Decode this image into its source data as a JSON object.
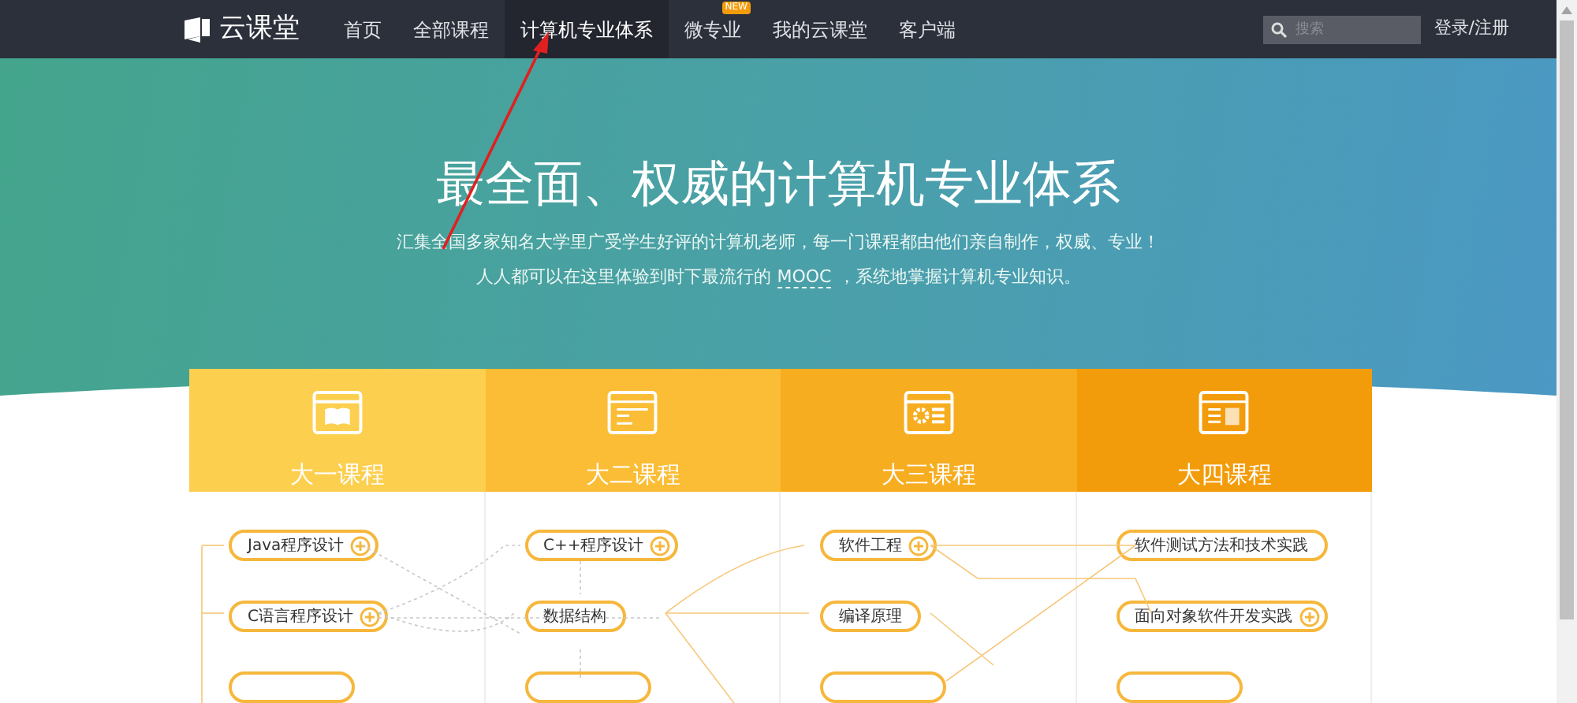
{
  "nav": {
    "logo": "云课堂",
    "items": [
      {
        "label": "首页",
        "selected": false
      },
      {
        "label": "全部课程",
        "selected": false
      },
      {
        "label": "计算机专业体系",
        "selected": true
      },
      {
        "label": "微专业",
        "selected": false,
        "badge": "NEW"
      },
      {
        "label": "我的云课堂",
        "selected": false
      },
      {
        "label": "客户端",
        "selected": false
      }
    ],
    "search": {
      "placeholder": "搜索"
    },
    "login": "登录/注册"
  },
  "hero": {
    "title": "最全面、权威的计算机专业体系",
    "lines": [
      [
        {
          "kind": "plain",
          "text": "汇集全国多家知名大学里广受学生好评的计算机老师，每一门课程都由他们亲自制作，权威、专业！"
        }
      ],
      [
        {
          "kind": "plain",
          "text": "人人都可以在这里体验到时下最流行的"
        },
        {
          "kind": "link",
          "text": "MOOC"
        },
        {
          "kind": "plain",
          "text": "，系统地掌握计算机专业知识。"
        }
      ]
    ]
  },
  "years": [
    {
      "title": "大一课程",
      "color": "#fdcf4f",
      "courses": [
        {
          "label": "Java程序设计",
          "expandable": true
        },
        {
          "label": "C语言程序设计",
          "expandable": true
        }
      ]
    },
    {
      "title": "大二课程",
      "color": "#fbbd35",
      "courses": [
        {
          "label": "C++程序设计",
          "expandable": true
        },
        {
          "label": "数据结构",
          "expandable": false
        }
      ]
    },
    {
      "title": "大三课程",
      "color": "#f7ad20",
      "courses": [
        {
          "label": "软件工程",
          "expandable": true
        },
        {
          "label": "编译原理",
          "expandable": false
        }
      ]
    },
    {
      "title": "大四课程",
      "color": "#f39c0b",
      "courses": [
        {
          "label": "软件测试方法和技术实践",
          "expandable": false
        },
        {
          "label": "面向对象软件开发实践",
          "expandable": true
        }
      ]
    }
  ]
}
